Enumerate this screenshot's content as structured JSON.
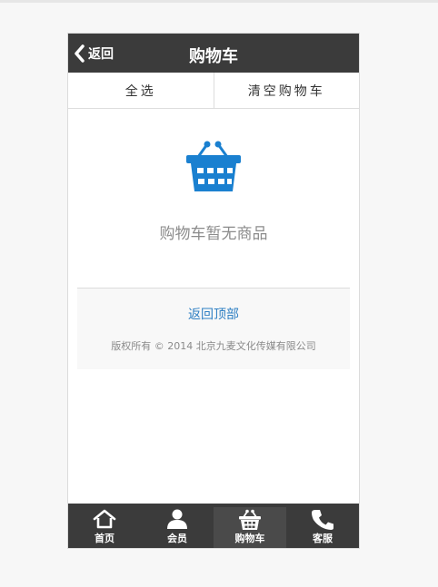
{
  "header": {
    "back_label": "返回",
    "title": "购物车"
  },
  "actions": {
    "select_all": "全选",
    "clear_cart": "清空购物车"
  },
  "empty": {
    "message": "购物车暂无商品",
    "icon": "basket-icon",
    "icon_color": "#1a80d0"
  },
  "footer": {
    "back_to_top": "返回顶部",
    "copyright": "版权所有 © 2014 北京九麦文化传媒有限公司"
  },
  "tabbar": {
    "items": [
      {
        "label": "首页",
        "icon": "home-icon"
      },
      {
        "label": "会员",
        "icon": "user-icon"
      },
      {
        "label": "购物车",
        "icon": "basket-icon",
        "active": true
      },
      {
        "label": "客服",
        "icon": "phone-icon"
      }
    ]
  },
  "colors": {
    "header_bg": "#3b3b3b",
    "link": "#2e7fc3",
    "accent": "#1a80d0"
  }
}
